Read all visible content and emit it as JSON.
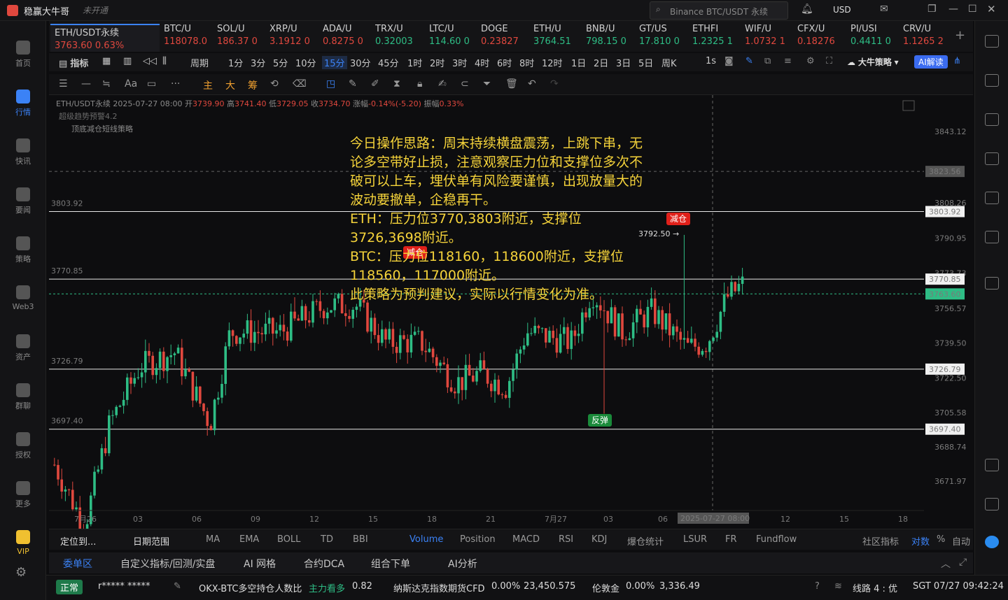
{
  "app": {
    "name": "稳赢大牛哥",
    "status": "未开通",
    "search_placeholder": "Binance BTC/USDT 永续",
    "currency": "USD"
  },
  "leftnav": [
    {
      "label": "首页"
    },
    {
      "label": "行情"
    },
    {
      "label": "快讯"
    },
    {
      "label": "要闻"
    },
    {
      "label": "策略"
    },
    {
      "label": "Web3"
    },
    {
      "label": "资产"
    },
    {
      "label": "群聊"
    },
    {
      "label": "授权"
    },
    {
      "label": "更多"
    },
    {
      "label": "VIP"
    }
  ],
  "tickers": [
    {
      "name": "ETH/USDT永续",
      "value": "3763.60 0.63%",
      "color": "red"
    },
    {
      "name": "BTC/U",
      "value": "118078.0",
      "color": "red"
    },
    {
      "name": "SOL/U",
      "value": "186.37 0",
      "color": "red"
    },
    {
      "name": "XRP/U",
      "value": "3.1912 0",
      "color": "red"
    },
    {
      "name": "ADA/U",
      "value": "0.8275 0",
      "color": "red"
    },
    {
      "name": "TRX/U",
      "value": "0.32003",
      "color": "green"
    },
    {
      "name": "LTC/U",
      "value": "114.60 0",
      "color": "green"
    },
    {
      "name": "DOGE",
      "value": "0.23827",
      "color": "red"
    },
    {
      "name": "ETH/U",
      "value": "3764.51",
      "color": "green"
    },
    {
      "name": "BNB/U",
      "value": "798.15 0",
      "color": "green"
    },
    {
      "name": "GT/US",
      "value": "17.810 0",
      "color": "green"
    },
    {
      "name": "ETHFI",
      "value": "1.2325 1",
      "color": "green"
    },
    {
      "name": "WIF/U",
      "value": "1.0732 1",
      "color": "red"
    },
    {
      "name": "CFX/U",
      "value": "0.18276",
      "color": "red"
    },
    {
      "name": "PI/USI",
      "value": "0.4411 0",
      "color": "green"
    },
    {
      "name": "CRV/U",
      "value": "1.1265 2",
      "color": "red"
    }
  ],
  "toolbar": {
    "indicator": "指标",
    "period": "周期",
    "timeframes": [
      "1分",
      "3分",
      "5分",
      "10分",
      "15分",
      "30分",
      "45分",
      "1时",
      "2时",
      "3时",
      "4时",
      "6时",
      "8时",
      "12时",
      "1日",
      "2日",
      "3日",
      "5日",
      "周K"
    ],
    "active_tf": "15分",
    "sec": "1s",
    "strategy": "大牛策略",
    "ai": "AI解读"
  },
  "drawtools": [
    "主",
    "大",
    "筹"
  ],
  "ohlc": {
    "symbol": "ETH/USDT永续",
    "time": "2025-07-27 08:00",
    "open_l": "开",
    "open": "3739.90",
    "high_l": "高",
    "high": "3741.40",
    "low_l": "低",
    "low": "3729.05",
    "close_l": "收",
    "close": "3734.70",
    "chg_l": "涨幅",
    "chg": "-0.14%(-5.20)",
    "amp_l": "振幅",
    "amp": "0.33%"
  },
  "overlays": [
    "超级趋势预警4.2",
    "顶底减仓短线策略"
  ],
  "strategy_text": "今日操作思路：周末持续横盘震荡，上跳下串，无论多空带好止损，注意观察压力位和支撑位多次不破可以上车，埋伏单有风险要谨慎，出现放量大的波动要撤单，企稳再干。\nETH：压力位3770,3803附近，支撑位3726,3698附近。\nBTC：压力位118160，118600附近，支撑位118560，117000附近。\n此策略为预判建议，实际以行情变化为准。",
  "signals": {
    "reduce1": "减仓",
    "reduce2": "减仓",
    "rebound": "反弹",
    "peak": "3792.50 →"
  },
  "chart_data": {
    "type": "candlestick",
    "price_axis_ticks": [
      3843.12,
      3808.26,
      3790.95,
      3773.73,
      3756.57,
      3739.5,
      3722.5,
      3705.58,
      3688.74,
      3671.97
    ],
    "time_axis": [
      "7月26",
      "03",
      "06",
      "09",
      "12",
      "15",
      "18",
      "21",
      "7月27",
      "03",
      "06",
      "12",
      "15",
      "18"
    ],
    "horizontal_lines": [
      3803.92,
      3770.85,
      3726.79,
      3697.4
    ],
    "crosshair_price": 3823.56,
    "last_price": 3763.6,
    "crosshair_time": "2025-07-27 08:00",
    "ylim": [
      3660,
      3860
    ]
  },
  "indicators": {
    "locate": "定位到...",
    "range": "日期范围",
    "list": [
      "MA",
      "EMA",
      "BOLL",
      "TD",
      "BBI"
    ],
    "sub": [
      "Volume",
      "Position",
      "MACD",
      "RSI",
      "KDJ",
      "爆仓统计",
      "LSUR",
      "FR",
      "Fundflow"
    ],
    "community": "社区指标",
    "compare": "对数",
    "percent": "%",
    "auto": "自动"
  },
  "panels": [
    "委单区",
    "自定义指标/回测/实盘",
    "AI 网格",
    "合约DCA",
    "组合下单",
    "AI分析"
  ],
  "status": {
    "state": "正常",
    "user": "r*****  *****",
    "ticker1": "OKX-BTC多空持仓人数比",
    "ticker1b": "主力看多",
    "ticker1v": "0.82",
    "ticker2": "纳斯达克指数期货CFD",
    "ticker2v": "0.00%",
    "ticker2p": "23,450.575",
    "ticker3": "伦敦金",
    "ticker3v": "0.00%",
    "ticker3p": "3,336.49",
    "line": "线路 4 : 优",
    "time": "SGT 07/27 09:42:24"
  }
}
